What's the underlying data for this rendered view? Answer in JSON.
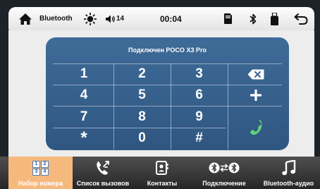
{
  "status": {
    "bluetooth_label": "Bluetooth",
    "volume": "14",
    "time": "00:04"
  },
  "dialer": {
    "title": "Подключен POCO X3 Pro",
    "keys": [
      "1",
      "2",
      "3",
      "4",
      "5",
      "6",
      "7",
      "8",
      "9",
      "*",
      "0",
      "#"
    ]
  },
  "tabs": [
    {
      "label": "Набор номера",
      "icon": "dialpad-icon",
      "active": true
    },
    {
      "label": "Список вызовов",
      "icon": "call-log-icon"
    },
    {
      "label": "Контакты",
      "icon": "contacts-icon"
    },
    {
      "label": "Подключение",
      "icon": "bluetooth-connect-icon"
    },
    {
      "label": "Bluetooth-аудио",
      "icon": "music-note-icon"
    }
  ],
  "dialpad_icon_digits": [
    "1",
    "2",
    "3",
    "4"
  ],
  "colors": {
    "pad": "#3a6593",
    "active_tab": "#f6b97d",
    "call": "#5fd07a"
  }
}
